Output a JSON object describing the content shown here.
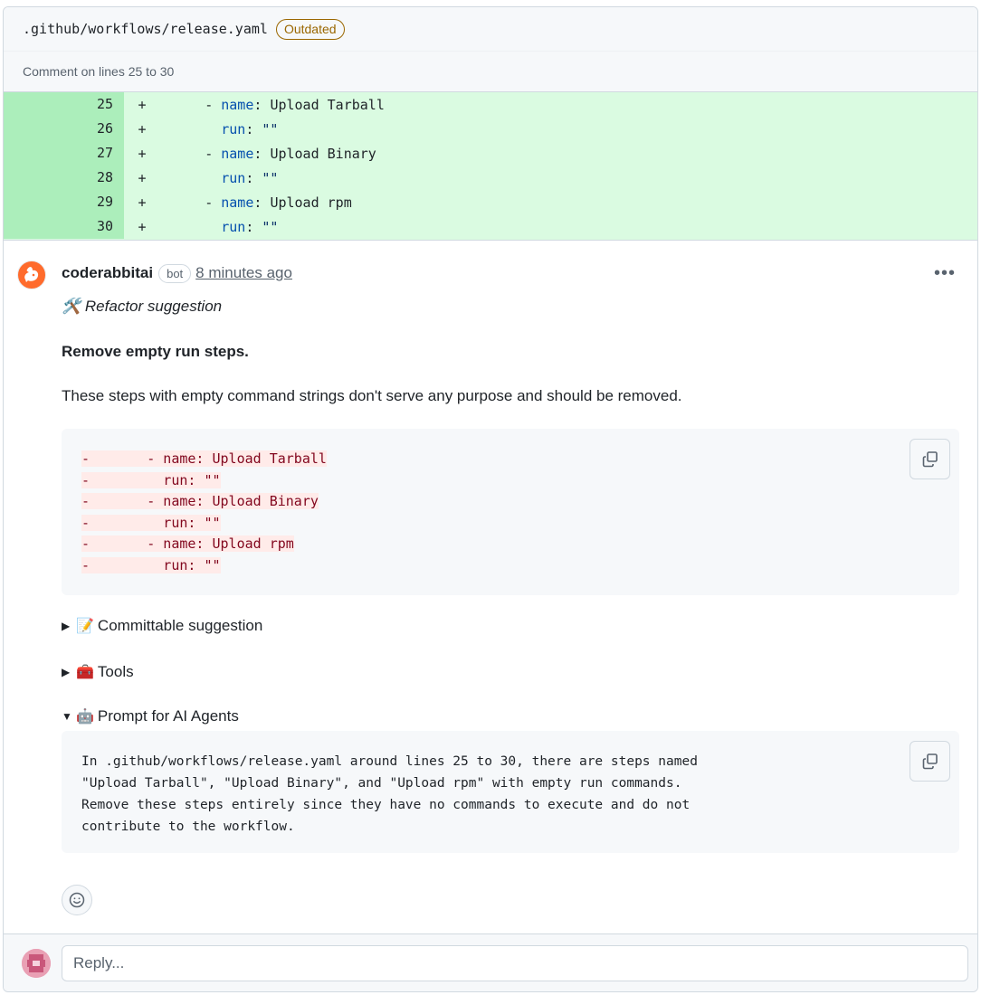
{
  "file": {
    "path": ".github/workflows/release.yaml",
    "badge": "Outdated",
    "comment_on": "Comment on lines 25 to 30"
  },
  "diff": [
    {
      "num": "25",
      "sign": "+",
      "indent": "      ",
      "dash": "- ",
      "key": "name",
      "sep": ": ",
      "value": "Upload Tarball"
    },
    {
      "num": "26",
      "sign": "+",
      "indent": "        ",
      "dash": "",
      "key": "run",
      "sep": ": ",
      "value": "\"\""
    },
    {
      "num": "27",
      "sign": "+",
      "indent": "      ",
      "dash": "- ",
      "key": "name",
      "sep": ": ",
      "value": "Upload Binary"
    },
    {
      "num": "28",
      "sign": "+",
      "indent": "        ",
      "dash": "",
      "key": "run",
      "sep": ": ",
      "value": "\"\""
    },
    {
      "num": "29",
      "sign": "+",
      "indent": "      ",
      "dash": "- ",
      "key": "name",
      "sep": ": ",
      "value": "Upload rpm"
    },
    {
      "num": "30",
      "sign": "+",
      "indent": "        ",
      "dash": "",
      "key": "run",
      "sep": ": ",
      "value": "\"\""
    }
  ],
  "comment": {
    "author": "coderabbitai",
    "bot_badge": "bot",
    "time": "8 minutes ago",
    "menu_icon": "kebab-horizontal-icon",
    "refactor_emoji": "🛠️",
    "refactor": "Refactor suggestion",
    "heading": "Remove empty run steps.",
    "paragraph": "These steps with empty command strings don't serve any purpose and should be removed.",
    "suggestion_lines": [
      "-       - name: Upload Tarball",
      "-         run: \"\"",
      "-       - name: Upload Binary",
      "-         run: \"\"",
      "-       - name: Upload rpm",
      "-         run: \"\""
    ],
    "details": [
      {
        "marker": "▶",
        "emoji": "📝",
        "label": "Committable suggestion"
      },
      {
        "marker": "▶",
        "emoji": "🧰",
        "label": "Tools"
      },
      {
        "marker": "▼",
        "emoji": "🤖",
        "label": "Prompt for AI Agents"
      }
    ],
    "prompt_lines": [
      "In .github/workflows/release.yaml around lines 25 to 30, there are steps named",
      "\"Upload Tarball\", \"Upload Binary\", and \"Upload rpm\" with empty run commands.",
      "Remove these steps entirely since they have no commands to execute and do not",
      "contribute to the workflow."
    ]
  },
  "reply": {
    "placeholder": "Reply..."
  },
  "colors": {
    "addition_bg": "#dafbe1",
    "addition_num_bg": "#aceebb",
    "deletion_bg": "#ffebe9",
    "deletion_text": "#82071e",
    "outdated": "#9a6700",
    "brand_orange": "#ff6b2c"
  }
}
